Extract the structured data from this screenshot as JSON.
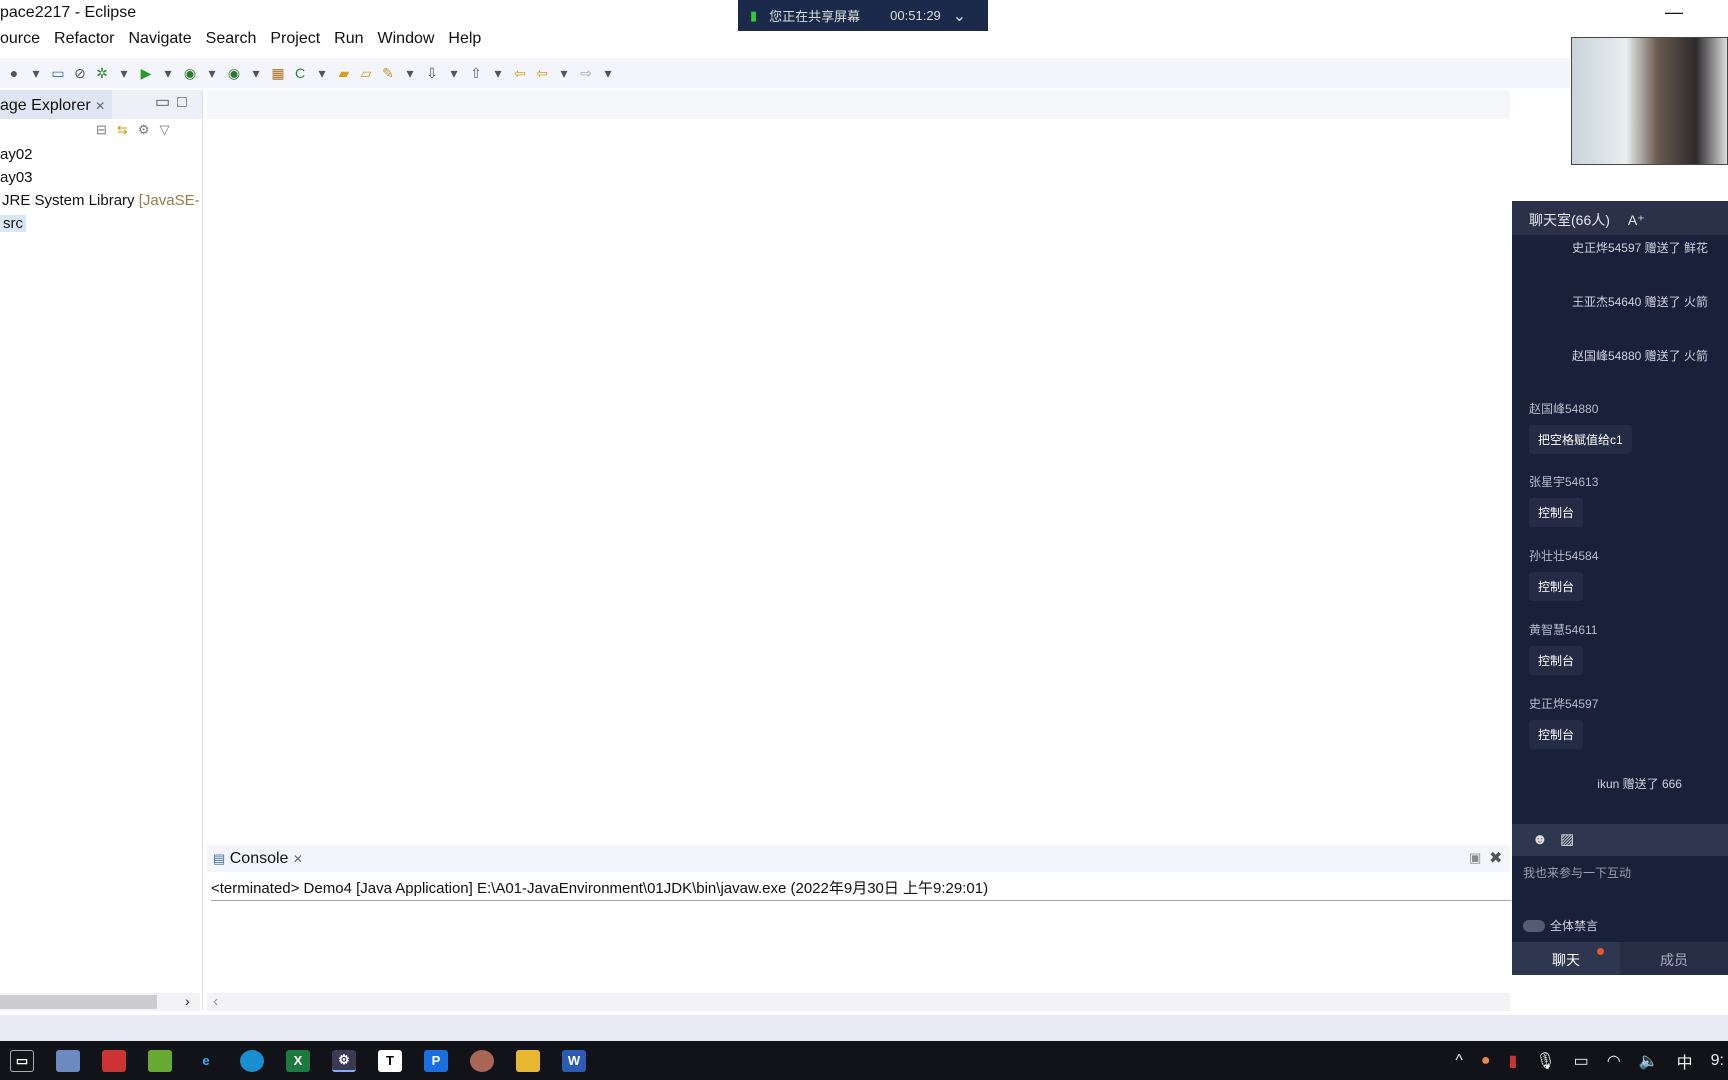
{
  "window": {
    "title": "pace2217 - Eclipse",
    "minimize": "—"
  },
  "menu": [
    "ource",
    "Refactor",
    "Navigate",
    "Search",
    "Project",
    "Run",
    "Window",
    "Help"
  ],
  "toolbar_icons": [
    "profile-icon",
    "dropdown-icon",
    "terminal-icon",
    "skip-breakpoints-icon",
    "debug-icon",
    "dropdown-icon",
    "run-icon",
    "dropdown-icon",
    "coverage-icon",
    "dropdown-icon",
    "external-tools-icon",
    "dropdown-icon",
    "new-package-icon",
    "new-class-icon",
    "dropdown-icon",
    "open-type-icon",
    "open-folder-icon",
    "pen-icon",
    "dropdown-icon",
    "next-annotation-icon",
    "dropdown-icon",
    "prev-annotation-icon",
    "dropdown-icon",
    "last-edit-icon",
    "back-icon",
    "dropdown-icon",
    "forward-icon",
    "dropdown-icon"
  ],
  "sharing": {
    "label": "您正在共享屏幕",
    "time": "00:51:29"
  },
  "explorer": {
    "tab": "age Explorer",
    "items": [
      {
        "label": "ay02"
      },
      {
        "label": "ay03"
      },
      {
        "label": "JRE System Library",
        "suffix": "[JavaSE-"
      },
      {
        "label": "src"
      }
    ]
  },
  "console": {
    "tab": "Console",
    "line": "<terminated> Demo4 [Java Application] E:\\A01-JavaEnvironment\\01JDK\\bin\\javaw.exe (2022年9月30日 上午9:29:01)"
  },
  "chat": {
    "title": "聊天室(66人)",
    "font_button": "A⁺",
    "gifts": [
      "史正烨54597 赠送了 鲜花",
      "王亚杰54640 赠送了 火箭",
      "赵国峰54880 赠送了 火箭"
    ],
    "messages": [
      {
        "name": "赵国峰54880",
        "text": "把空格赋值给c1"
      },
      {
        "name": "张星宇54613",
        "text": "控制台"
      },
      {
        "name": "孙壮壮54584",
        "text": "控制台"
      },
      {
        "name": "黄智慧54611",
        "text": "控制台"
      },
      {
        "name": "史正烨54597",
        "text": "控制台"
      }
    ],
    "last_gift": "ikun 赠送了 666",
    "input_placeholder": "我也来参与一下互动",
    "mute_all": "全体禁言",
    "tabs": [
      "聊天",
      "成员"
    ],
    "accent": "#e8552e"
  },
  "taskbar": {
    "tray": [
      "^",
      "中",
      "9:"
    ]
  }
}
